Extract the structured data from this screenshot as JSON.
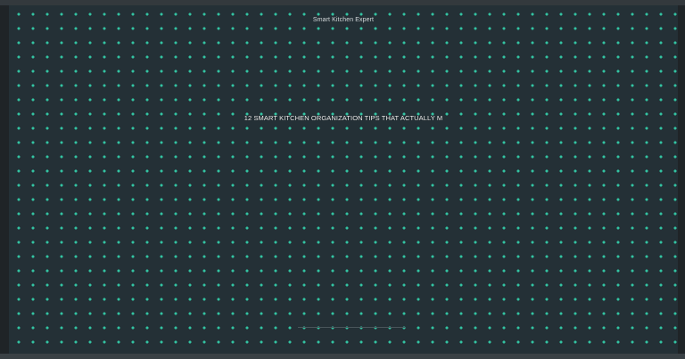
{
  "video": {
    "channel_name": "Smart Kitchen Expert",
    "title": "12 SMART KITCHEN ORGANIZATION TIPS THAT ACTUALLY M"
  },
  "colors": {
    "background": "#243036",
    "dots": "#33c4a2",
    "text": "#f3f5f6"
  }
}
